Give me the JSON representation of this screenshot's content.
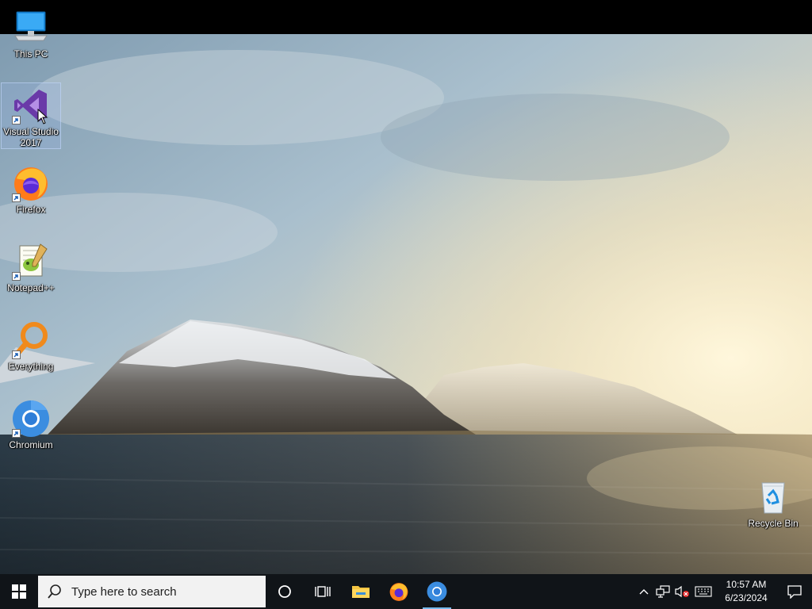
{
  "desktop": {
    "icons": [
      {
        "label": "This PC",
        "icon": "this-pc-icon"
      },
      {
        "label": "Visual Studio 2017",
        "icon": "visual-studio-icon",
        "selected": true
      },
      {
        "label": "Firefox",
        "icon": "firefox-icon"
      },
      {
        "label": "Notepad++",
        "icon": "notepad-plus-plus-icon"
      },
      {
        "label": "Everything",
        "icon": "everything-search-icon"
      },
      {
        "label": "Chromium",
        "icon": "chromium-icon"
      },
      {
        "label": "Recycle Bin",
        "icon": "recycle-bin-icon"
      }
    ]
  },
  "taskbar": {
    "search": {
      "placeholder": "Type here to search"
    },
    "pinned": [
      {
        "name": "Cortana",
        "icon": "cortana-circle-icon"
      },
      {
        "name": "Task View",
        "icon": "task-view-icon"
      },
      {
        "name": "File Explorer",
        "icon": "file-explorer-icon"
      },
      {
        "name": "Firefox",
        "icon": "firefox-icon"
      },
      {
        "name": "Chromium",
        "icon": "chromium-icon",
        "active": true
      }
    ],
    "tray": {
      "icons": [
        "chevron-up-icon",
        "network-icon",
        "volume-muted-icon",
        "keyboard-icon"
      ],
      "time": "10:57 AM",
      "date": "6/23/2024"
    }
  },
  "colors": {
    "taskbar_bg": "#101418",
    "accent": "#76b9ed",
    "search_bg": "#f2f2f2"
  }
}
